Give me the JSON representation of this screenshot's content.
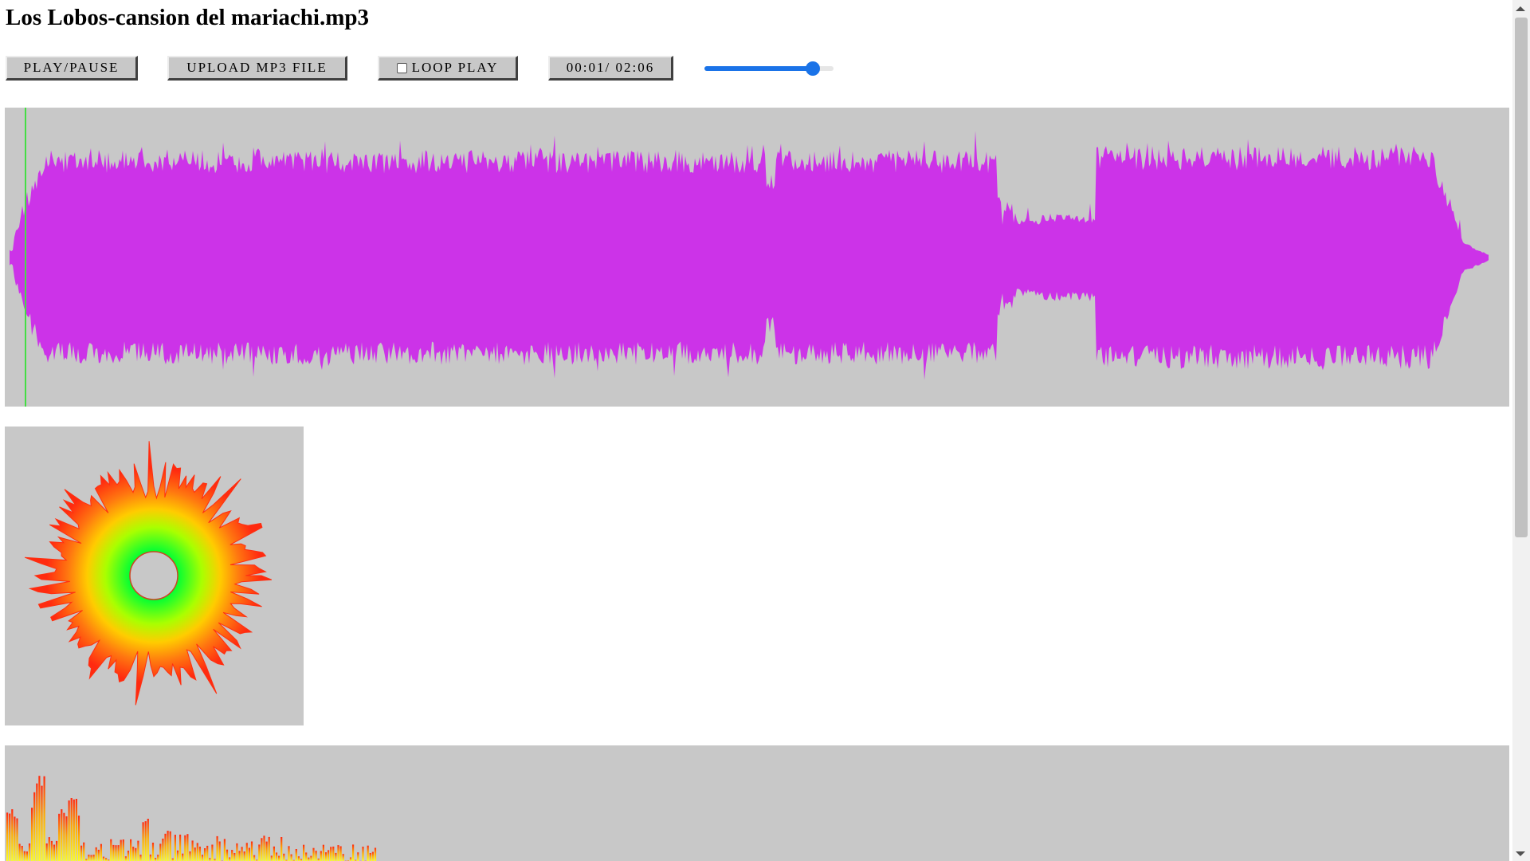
{
  "player": {
    "title": "Los Lobos-cansion del mariachi.mp3",
    "play_pause_label": "PLAY/PAUSE",
    "upload_label": "UPLOAD MP3 FILE",
    "loop_label": "LOOP PLAY",
    "loop_checked": false,
    "time_display": "00:01/ 02:06",
    "volume_fraction": 0.84,
    "playback_fraction": 0.008
  },
  "colors": {
    "panel_background": "#c8c8c8",
    "waveform": "#cc33e8",
    "playhead": "#44dd44",
    "slider_accent": "#1a73e8",
    "spectrum_low": "#ffff22",
    "spectrum_high": "#ff2a10"
  },
  "visualizers": {
    "waveform": "waveform-visualizer",
    "radial": "radial-spectrum-visualizer",
    "spectrum": "frequency-bars-visualizer"
  }
}
